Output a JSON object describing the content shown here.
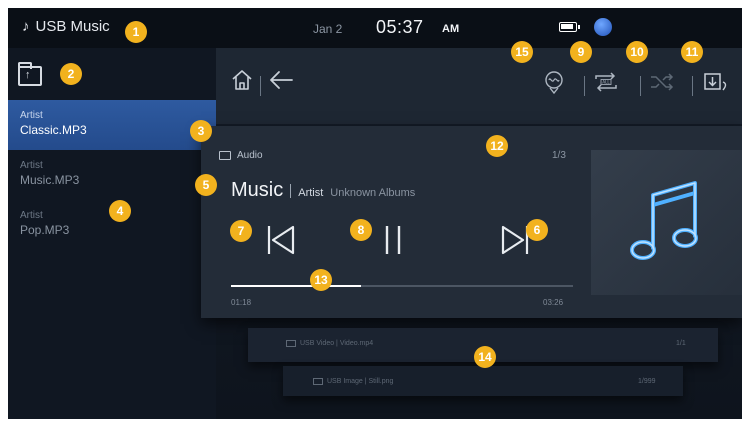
{
  "status_bar": {
    "source_label": "USB Music",
    "date": "Jan 2",
    "time": "05:37",
    "ampm": "AM"
  },
  "left_panel": {
    "items": [
      {
        "artist": "Artist",
        "file": "Classic.MP3",
        "active": true
      },
      {
        "artist": "Artist",
        "file": "Music.MP3",
        "active": false
      },
      {
        "artist": "Artist",
        "file": "Pop.MP3",
        "active": false
      }
    ]
  },
  "now_playing": {
    "folder": "Audio",
    "track_count": "1/3",
    "title": "Music",
    "artist": "Artist",
    "album": "Unknown Albums",
    "current_time": "01:18",
    "duration": "03:26",
    "progress_fraction": 0.38
  },
  "stacked_cards": {
    "video_label": "USB Video | Video.mp4",
    "video_count": "1/1",
    "image_label": "USB Image | Still.png",
    "image_count": "1/999"
  },
  "callouts": [
    "1",
    "2",
    "3",
    "4",
    "5",
    "6",
    "7",
    "8",
    "9",
    "10",
    "11",
    "12",
    "13",
    "14",
    "15"
  ],
  "colors": {
    "accent_selected": "#2e5aa0",
    "callout_badge": "#f2b21e",
    "album_note": "#4fb0ff"
  }
}
